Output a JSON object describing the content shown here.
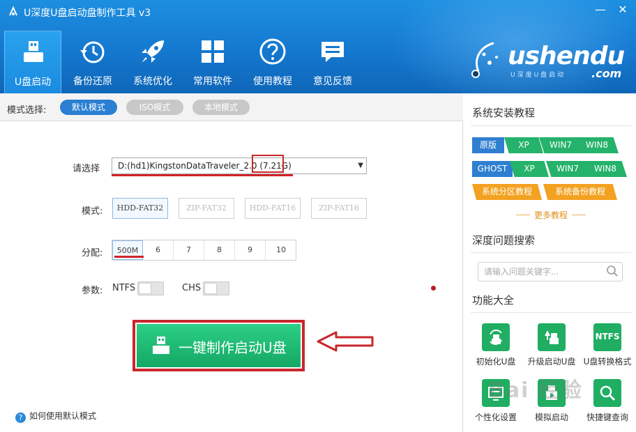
{
  "window": {
    "title": "U深度U盘启动盘制作工具 v3",
    "minimize_glyph": "—",
    "close_glyph": "✕"
  },
  "nav": {
    "items": [
      {
        "label": "U盘启动",
        "icon": "usb-drive-icon",
        "active": true
      },
      {
        "label": "备份还原",
        "icon": "history-clock-icon",
        "active": false
      },
      {
        "label": "系统优化",
        "icon": "rocket-icon",
        "active": false
      },
      {
        "label": "常用软件",
        "icon": "apps-grid-icon",
        "active": false
      },
      {
        "label": "使用教程",
        "icon": "question-icon",
        "active": false
      },
      {
        "label": "意见反馈",
        "icon": "message-icon",
        "active": false
      }
    ]
  },
  "brand": {
    "name": "ushendu",
    "suffix": ".com",
    "subtitle": "U深度U盘启动"
  },
  "mode_bar": {
    "label": "模式选择:",
    "modes": [
      {
        "label": "默认模式",
        "selected": true
      },
      {
        "label": "ISO模式",
        "selected": false
      },
      {
        "label": "本地模式",
        "selected": false
      }
    ]
  },
  "form": {
    "select_label": "请选择",
    "drive_value": "D:(hd1)KingstonDataTraveler_2.0 (7.21G)",
    "mode_label": "模式:",
    "formats": [
      {
        "label": "HDD-FAT32",
        "selected": true
      },
      {
        "label": "ZIP-FAT32",
        "selected": false
      },
      {
        "label": "HDD-FAT16",
        "selected": false
      },
      {
        "label": "ZIP-FAT16",
        "selected": false
      }
    ],
    "partition_label": "分配:",
    "partitions": [
      {
        "label": "500M",
        "selected": true
      },
      {
        "label": "6",
        "selected": false
      },
      {
        "label": "7",
        "selected": false
      },
      {
        "label": "8",
        "selected": false
      },
      {
        "label": "9",
        "selected": false
      },
      {
        "label": "10",
        "selected": false
      }
    ],
    "params_label": "参数:",
    "ntfs_label": "NTFS",
    "chs_label": "CHS",
    "make_button": "一键制作启动U盘",
    "help_link": "如何使用默认模式"
  },
  "sidebar": {
    "install_title": "系统安装教程",
    "row1": [
      "原版",
      "XP",
      "WIN7",
      "WIN8"
    ],
    "row2": [
      "GHOST",
      "XP",
      "WIN7",
      "WIN8"
    ],
    "row3": [
      "系统分区教程",
      "系统备份教程"
    ],
    "more": "更多教程",
    "search_title": "深度问题搜索",
    "search_placeholder": "请输入问题关键字...",
    "tools_title": "功能大全",
    "tools": [
      {
        "label": "初始化U盘",
        "icon": "init-usb-icon"
      },
      {
        "label": "升级启动U盘",
        "icon": "upgrade-usb-icon"
      },
      {
        "label": "U盘转换格式",
        "icon": "ntfs-convert-icon",
        "badge": "NTFS"
      },
      {
        "label": "个性化设置",
        "icon": "personalize-icon"
      },
      {
        "label": "模拟启动",
        "icon": "simulate-boot-icon"
      },
      {
        "label": "快捷键查询",
        "icon": "hotkey-icon"
      }
    ]
  },
  "watermark": "Bai 经验",
  "colors": {
    "header_blue": "#1478cf",
    "accent_green": "#1fae62",
    "tag_blue": "#2f7fd1",
    "tag_green": "#25b26a",
    "tag_orange": "#f3a120",
    "highlight_red": "#c8262b"
  }
}
